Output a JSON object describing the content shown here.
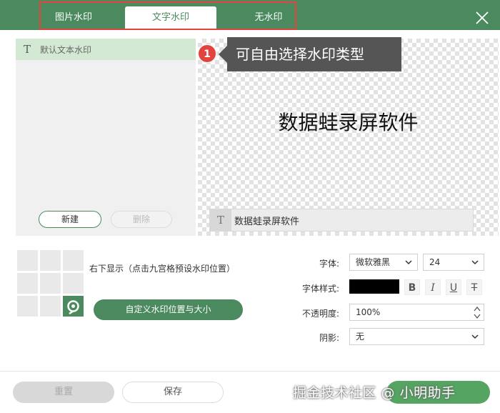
{
  "tabs": [
    {
      "label": "图片水印",
      "active": false
    },
    {
      "label": "文字水印",
      "active": true
    },
    {
      "label": "无水印",
      "active": false
    }
  ],
  "list": {
    "items": [
      {
        "label": "默认文本水印",
        "selected": true
      }
    ],
    "new_button": "新建",
    "delete_button": "删除"
  },
  "preview": {
    "watermark_text": "数据蛙录屏软件",
    "text_input_value": "数据蛙录屏软件"
  },
  "callout": {
    "number": "1",
    "text": "可自由选择水印类型"
  },
  "position": {
    "description": "右下显示（点击九宫格预设水印位置）",
    "selected_cell": 9,
    "custom_button": "自定义水印位置与大小"
  },
  "settings": {
    "font_label": "字体:",
    "font_value": "微软雅黑",
    "font_size_value": "24",
    "style_label": "字体样式:",
    "color": "#000000",
    "bold": "B",
    "italic": "I",
    "underline": "U",
    "strike": "T",
    "opacity_label": "不透明度:",
    "opacity_value": "100%",
    "shadow_label": "阴影:",
    "shadow_value": "无"
  },
  "footer": {
    "reset_button": "重置",
    "save_button": "保存",
    "watermark_credit": "掘金技术社区 @ 小明助手"
  },
  "colors": {
    "accent_green": "#4a8a5e",
    "highlight_red": "#e2443d"
  }
}
